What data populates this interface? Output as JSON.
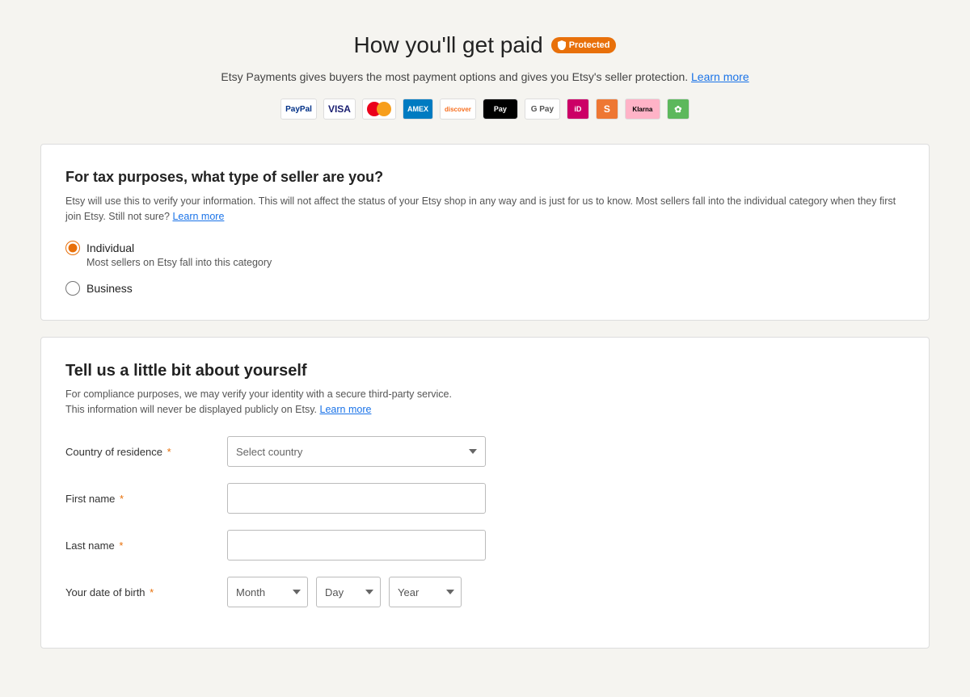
{
  "header": {
    "title": "How you'll get paid",
    "badge_label": "Protected",
    "subtitle": "Etsy Payments gives buyers the most payment options and gives you Etsy's seller protection.",
    "learn_more_link": "Learn more",
    "payment_icons": [
      {
        "name": "paypal",
        "label": "PayPal"
      },
      {
        "name": "visa",
        "label": "VISA"
      },
      {
        "name": "mastercard",
        "label": "MC"
      },
      {
        "name": "amex",
        "label": "AMEX"
      },
      {
        "name": "discover",
        "label": "DISCOVER"
      },
      {
        "name": "applepay",
        "label": "Apple Pay"
      },
      {
        "name": "gpay",
        "label": "G Pay"
      },
      {
        "name": "ideal",
        "label": "iD"
      },
      {
        "name": "sofort",
        "label": "S"
      },
      {
        "name": "klarna",
        "label": "Klarna"
      },
      {
        "name": "eco",
        "label": "✿"
      }
    ]
  },
  "seller_type_card": {
    "title": "For tax purposes, what type of seller are you?",
    "description": "Etsy will use this to verify your information. This will not affect the status of your Etsy shop in any way and is just for us to know. Most sellers fall into the individual category when they first join Etsy. Still not sure?",
    "learn_more_link": "Learn more",
    "options": [
      {
        "id": "individual",
        "label": "Individual",
        "sublabel": "Most sellers on Etsy fall into this category",
        "selected": true
      },
      {
        "id": "business",
        "label": "Business",
        "sublabel": "",
        "selected": false
      }
    ]
  },
  "about_section": {
    "title": "Tell us a little bit about yourself",
    "description_line1": "For compliance purposes, we may verify your identity with a secure third-party service.",
    "description_line2": "This information will never be displayed publicly on Etsy.",
    "learn_more_link": "Learn more",
    "fields": {
      "country": {
        "label": "Country of residence",
        "required": true,
        "placeholder": "Select country"
      },
      "first_name": {
        "label": "First name",
        "required": true,
        "placeholder": ""
      },
      "last_name": {
        "label": "Last name",
        "required": true,
        "placeholder": ""
      },
      "dob": {
        "label": "Your date of birth",
        "required": true,
        "month_placeholder": "Month",
        "day_placeholder": "Day",
        "year_placeholder": "Year"
      }
    }
  }
}
